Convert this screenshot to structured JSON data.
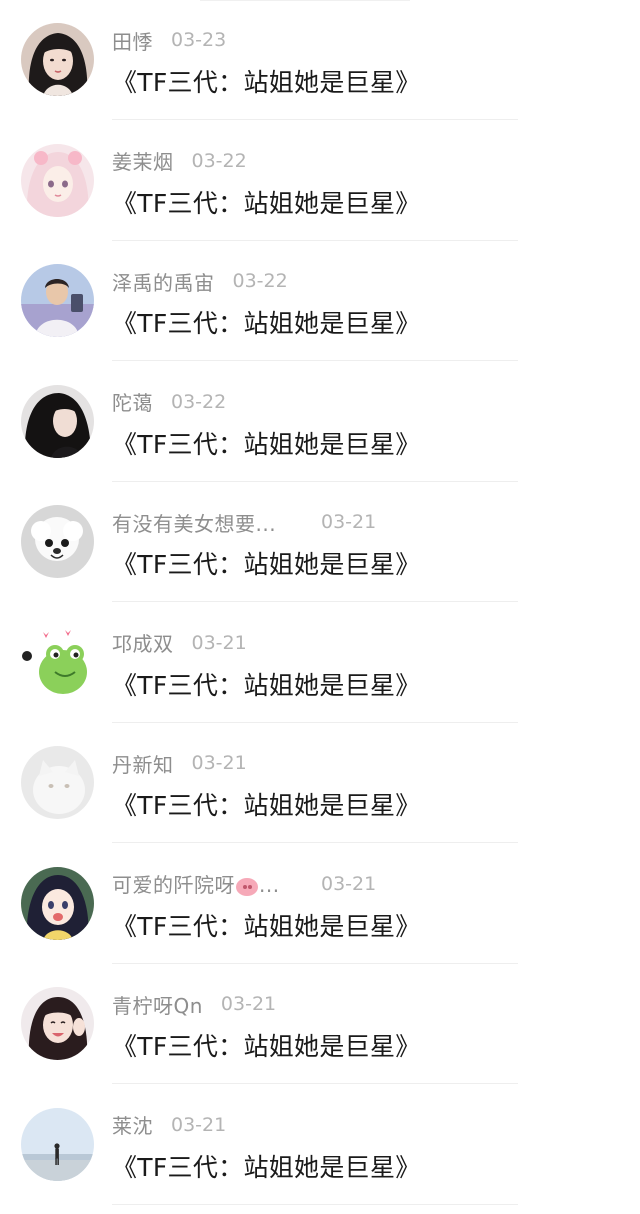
{
  "list": [
    {
      "name": "田悸",
      "date": "03-23",
      "content": "《TF三代：站姐她是巨星》",
      "avatar": "girl-dark-hair-avatar"
    },
    {
      "name": "姜茉烟",
      "date": "03-22",
      "content": "《TF三代：站姐她是巨星》",
      "avatar": "anime-pink-hair-avatar"
    },
    {
      "name": "泽禹的禹宙",
      "date": "03-22",
      "content": "《TF三代：站姐她是巨星》",
      "avatar": "boy-photo-avatar"
    },
    {
      "name": "陀蔼",
      "date": "03-22",
      "content": "《TF三代：站姐她是巨星》",
      "avatar": "girl-black-hair-avatar"
    },
    {
      "name": "有没有美女想要...",
      "date": "03-21",
      "content": "《TF三代：站姐她是巨星》",
      "avatar": "white-dog-avatar"
    },
    {
      "name": "邛成双",
      "date": "03-21",
      "content": "《TF三代：站姐她是巨星》",
      "avatar": "green-frog-avatar"
    },
    {
      "name": "丹新知",
      "date": "03-21",
      "content": "《TF三代：站姐她是巨星》",
      "avatar": "white-cat-avatar"
    },
    {
      "name": "可爱的阡院呀",
      "name_suffix": "...",
      "date": "03-21",
      "content": "《TF三代：站姐她是巨星》",
      "avatar": "anime-girl-avatar",
      "name_icon": "pig-emoji-icon"
    },
    {
      "name": "青柠呀Qn",
      "date": "03-21",
      "content": "《TF三代：站姐她是巨星》",
      "avatar": "girl-smiling-avatar"
    },
    {
      "name": "莱沈",
      "date": "03-21",
      "content": "《TF三代：站姐她是巨星》",
      "avatar": "seaside-person-avatar"
    }
  ],
  "colors": {
    "name": "#8e8e8e",
    "date": "#b4b4b4",
    "content": "#1a1a1a",
    "divider": "#eeeeee"
  }
}
